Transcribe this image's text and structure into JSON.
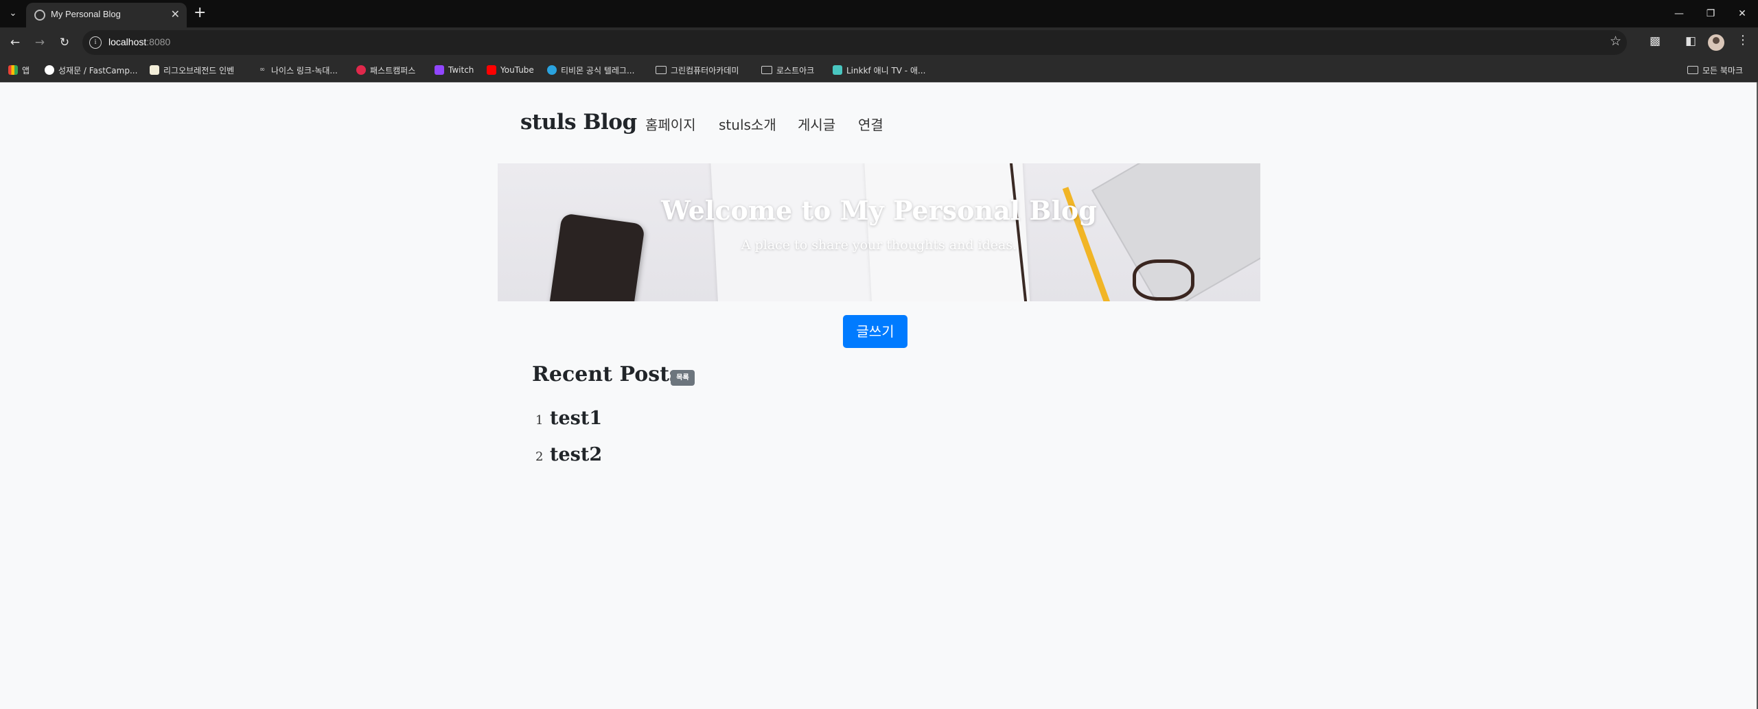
{
  "browser": {
    "tab_title": "My Personal Blog",
    "url_host": "localhost",
    "url_port": ":8080",
    "bookmarks": [
      {
        "label": "앱",
        "icon": "apps-grid-icon"
      },
      {
        "label": "성재문 / FastCamp...",
        "icon": "github-icon"
      },
      {
        "label": "리그오브레전드 인벤",
        "icon": "league-icon"
      },
      {
        "label": "나이스 링크-녹대...",
        "icon": "link-icon"
      },
      {
        "label": "패스트캠퍼스",
        "icon": "fastcampus-icon"
      },
      {
        "label": "Twitch",
        "icon": "twitch-icon"
      },
      {
        "label": "YouTube",
        "icon": "youtube-icon"
      },
      {
        "label": "티비몬 공식 텔레그...",
        "icon": "telegram-icon"
      },
      {
        "label": "그린컴퓨터아카데미",
        "icon": "folder-icon"
      },
      {
        "label": "로스트아크",
        "icon": "folder-icon"
      },
      {
        "label": "Linkkf 애니 TV - 애...",
        "icon": "linkkf-icon"
      }
    ],
    "all_bookmarks_label": "모든 북마크"
  },
  "site": {
    "brand": "stuls Blog",
    "nav": [
      "홈페이지",
      "stuls소개",
      "게시글",
      "연결"
    ],
    "hero": {
      "title": "Welcome to My Personal Blog",
      "subtitle": "A place to share your thoughts and ideas."
    },
    "write_button": "글쓰기",
    "recent_posts": {
      "title": "Recent Posts",
      "badge": "목록",
      "items": [
        {
          "num": "1",
          "title": "test1"
        },
        {
          "num": "2",
          "title": "test2"
        }
      ]
    }
  }
}
